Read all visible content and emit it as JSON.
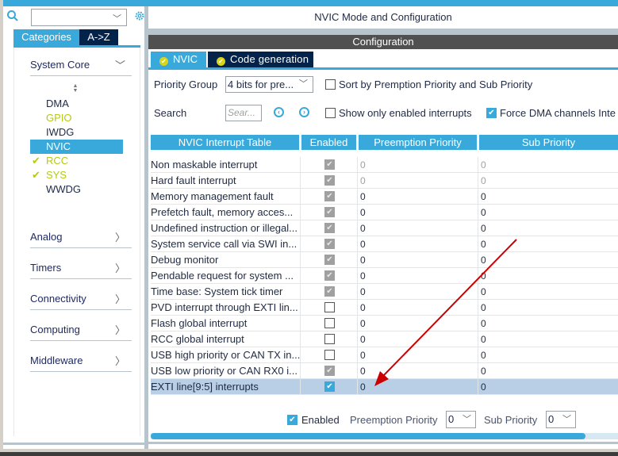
{
  "left_panel": {
    "search": {
      "value": "",
      "placeholder": ""
    },
    "tabs": [
      {
        "label": "Categories",
        "active": true
      },
      {
        "label": "A->Z",
        "active": false
      }
    ],
    "categories": [
      {
        "label": "System Core",
        "expanded": true
      },
      {
        "label": "Analog",
        "expanded": false
      },
      {
        "label": "Timers",
        "expanded": false
      },
      {
        "label": "Connectivity",
        "expanded": false
      },
      {
        "label": "Computing",
        "expanded": false
      },
      {
        "label": "Middleware",
        "expanded": false
      }
    ],
    "system_core_items": [
      {
        "label": "DMA",
        "status": "normal",
        "check": ""
      },
      {
        "label": "GPIO",
        "status": "configured",
        "check": ""
      },
      {
        "label": "IWDG",
        "status": "normal",
        "check": ""
      },
      {
        "label": "NVIC",
        "status": "selected",
        "check": ""
      },
      {
        "label": "RCC",
        "status": "configured",
        "check": "✔"
      },
      {
        "label": "SYS",
        "status": "configured",
        "check": "✔"
      },
      {
        "label": "WWDG",
        "status": "normal",
        "check": ""
      }
    ]
  },
  "header": {
    "title": "NVIC Mode and Configuration",
    "config_bar": "Configuration"
  },
  "config_tabs": [
    {
      "label": "NVIC",
      "active": true,
      "icon": "check-circle-icon"
    },
    {
      "label": "Code generation",
      "active": false,
      "icon": "check-circle-icon"
    }
  ],
  "controls": {
    "priority_group_label": "Priority Group",
    "priority_group_value": "4 bits for pre...",
    "sort_label": "Sort by Premption Priority and Sub Priority",
    "sort_checked": false,
    "search_label": "Search",
    "search_placeholder": "Sear...",
    "show_enabled_label": "Show only enabled interrupts",
    "show_enabled_checked": false,
    "force_dma_label": "Force DMA channels Inte",
    "force_dma_checked": true
  },
  "table": {
    "headers": [
      "NVIC Interrupt Table",
      "Enabled",
      "Preemption Priority",
      "Sub Priority"
    ],
    "rows": [
      {
        "name": "Non maskable interrupt",
        "enabled": "locked",
        "preemption": "0",
        "sub": "0",
        "dim": true,
        "selected": false
      },
      {
        "name": "Hard fault interrupt",
        "enabled": "locked",
        "preemption": "0",
        "sub": "0",
        "dim": true,
        "selected": false
      },
      {
        "name": "Memory management fault",
        "enabled": "locked",
        "preemption": "0",
        "sub": "0",
        "dim": false,
        "selected": false
      },
      {
        "name": "Prefetch fault, memory acces...",
        "enabled": "locked",
        "preemption": "0",
        "sub": "0",
        "dim": false,
        "selected": false
      },
      {
        "name": "Undefined instruction or illegal...",
        "enabled": "locked",
        "preemption": "0",
        "sub": "0",
        "dim": false,
        "selected": false
      },
      {
        "name": "System service call via SWI in...",
        "enabled": "locked",
        "preemption": "0",
        "sub": "0",
        "dim": false,
        "selected": false
      },
      {
        "name": "Debug monitor",
        "enabled": "locked",
        "preemption": "0",
        "sub": "0",
        "dim": false,
        "selected": false
      },
      {
        "name": "Pendable request for system ...",
        "enabled": "locked",
        "preemption": "0",
        "sub": "0",
        "dim": false,
        "selected": false
      },
      {
        "name": "Time base: System tick timer",
        "enabled": "locked",
        "preemption": "0",
        "sub": "0",
        "dim": false,
        "selected": false
      },
      {
        "name": "PVD interrupt through EXTI lin...",
        "enabled": "off",
        "preemption": "0",
        "sub": "0",
        "dim": false,
        "selected": false
      },
      {
        "name": "Flash global interrupt",
        "enabled": "off",
        "preemption": "0",
        "sub": "0",
        "dim": false,
        "selected": false
      },
      {
        "name": "RCC global interrupt",
        "enabled": "off",
        "preemption": "0",
        "sub": "0",
        "dim": false,
        "selected": false
      },
      {
        "name": "USB high priority or CAN TX in...",
        "enabled": "off",
        "preemption": "0",
        "sub": "0",
        "dim": false,
        "selected": false
      },
      {
        "name": "USB low priority or CAN RX0 i...",
        "enabled": "locked",
        "preemption": "0",
        "sub": "0",
        "dim": false,
        "selected": false
      },
      {
        "name": "EXTI line[9:5] interrupts",
        "enabled": "on",
        "preemption": "0",
        "sub": "0",
        "dim": false,
        "selected": true
      }
    ]
  },
  "bottom": {
    "enabled_label": "Enabled",
    "enabled_checked": true,
    "preemption_label": "Preemption Priority",
    "preemption_value": "0",
    "sub_label": "Sub Priority",
    "sub_value": "0"
  },
  "annotation": {
    "type": "arrow",
    "color": "#cc0000"
  },
  "colors": {
    "accent": "#39a9db",
    "dark_tab": "#03234b",
    "ok": "#b8c913",
    "selected_row": "#b8cfe6"
  }
}
